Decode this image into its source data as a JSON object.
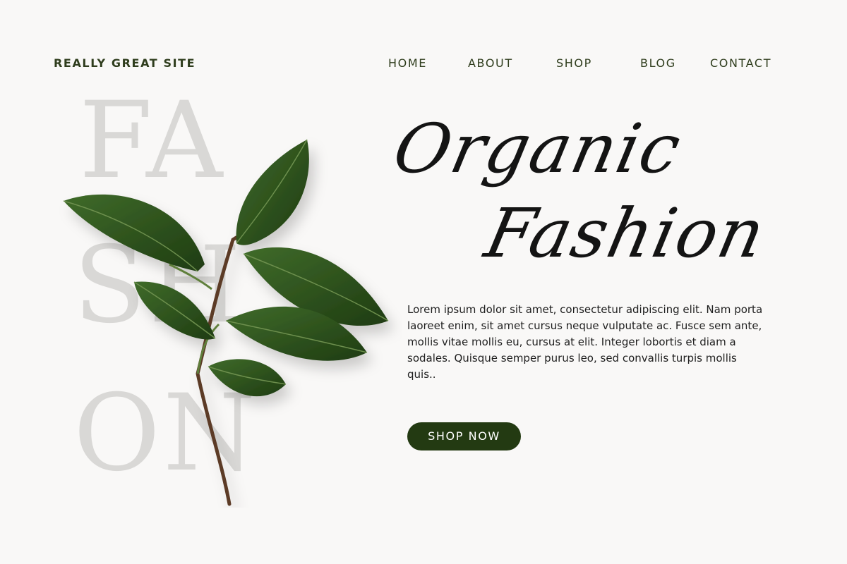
{
  "brand": "REALLY GREAT SITE",
  "nav": {
    "items": [
      "HOME",
      "ABOUT",
      "SHOP",
      "BLOG",
      "CONTACT"
    ]
  },
  "background_word": {
    "line1": "FA",
    "line2": "SH",
    "line3": "ON"
  },
  "hero": {
    "title_line1": "Organic",
    "title_line2": "Fashion",
    "body": "Lorem ipsum dolor sit amet, consectetur adipiscing elit. Nam porta laoreet enim, sit amet cursus neque vulputate ac. Fusce sem ante, mollis vitae mollis eu, cursus at elit. Integer lobortis et diam a sodales. Quisque semper purus leo, sed convallis turpis mollis quis..",
    "cta_label": "SHOP NOW"
  },
  "colors": {
    "background": "#f9f8f7",
    "text_dark_green": "#2f3d1d",
    "button": "#233a12",
    "ghost_text": "#d9d8d6"
  }
}
